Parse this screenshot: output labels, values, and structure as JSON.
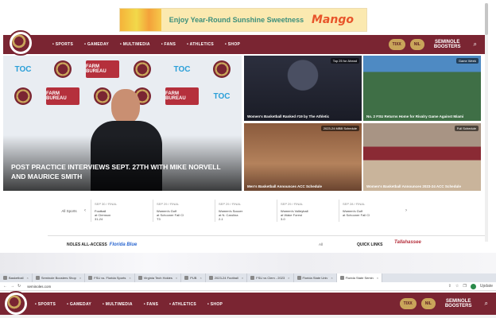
{
  "ad": {
    "tagline": "Enjoy Year-Round Sunshine Sweetness",
    "brand": "Mango"
  },
  "nav": {
    "links": [
      "• SPORTS",
      "• GAMEDAY",
      "• MULTIMEDIA",
      "• FANS",
      "• ATHLETICS",
      "• SHOP"
    ],
    "tickets": "TIXX",
    "nil": "NIL",
    "seminole_line1": "SEMINOLE",
    "seminole_line2": "BOOSTERS",
    "search_icon": "⌕"
  },
  "hero": {
    "title": "POST PRACTICE INTERVIEWS SEPT. 27TH WITH MIKE NORVELL AND MAURICE SMITH",
    "backdrop": [
      "TOC",
      "FARM BUREAU",
      "TOC",
      "FARM BUREAU",
      "TOC"
    ]
  },
  "tiles": [
    {
      "caption": "Women's Basketball Ranked #19 by The Athletic",
      "badge": "Top 25 for Ahead"
    },
    {
      "caption": "No. 2 FSU Returns Home for Rivalry Game Against Miami",
      "badge": "Game Week"
    },
    {
      "caption": "Men's Basketball Announces ACC Schedule",
      "badge": "2023-24 MBB Schedule"
    },
    {
      "caption": "Women's Basketball Announces 2023-24 ACC Schedule",
      "badge": "Full Schedule"
    }
  ],
  "scores": {
    "label": "All Sports",
    "prev_arrow": "‹",
    "next_arrow": "›",
    "items": [
      {
        "date": "SEP 30 / FINAL",
        "team": "Football",
        "opp": "at Clemson",
        "result": "W",
        "score": "31-24"
      },
      {
        "date": "SEP 29 / FINAL",
        "team": "Women's Golf",
        "opp": "at Schooner Fall Cl",
        "result": "T3",
        "score": ""
      },
      {
        "date": "SEP 29 / FINAL",
        "team": "Women's Soccer",
        "opp": "at N. Carolina",
        "result": "W",
        "score": "2-1"
      },
      {
        "date": "SEP 29 / FINAL",
        "team": "Women's Volleyball",
        "opp": "at Wake Forest",
        "result": "W",
        "score": "3-0"
      },
      {
        "date": "SEP 28 / FINAL",
        "team": "Women's Golf",
        "opp": "at Schooner Fall Cl",
        "result": "",
        "score": ""
      }
    ]
  },
  "allaccess": {
    "title": "NOLES ALL-ACCESS",
    "brand": "Florida Blue",
    "all_label": "All"
  },
  "quicklinks": {
    "title": "QUICK LINKS",
    "partner": "Tallahassee"
  },
  "browser": {
    "tabs": [
      {
        "label": "Basketball",
        "active": false
      },
      {
        "label": "Seminole Boosters Shop",
        "active": false
      },
      {
        "label": "FSU vs. Florida Sports",
        "active": false
      },
      {
        "label": "Virginia Tech Hokies",
        "active": false
      },
      {
        "label": "PUB",
        "active": false
      },
      {
        "label": "2023-24 Football",
        "active": false
      },
      {
        "label": "FSU vs Clem - 2023",
        "active": false
      },
      {
        "label": "Florida State Univ",
        "active": false
      },
      {
        "label": "Florida State Semin",
        "active": true
      }
    ],
    "url": "seminoles.com",
    "back": "←",
    "forward": "→",
    "reload": "↻",
    "update_label": "Update"
  }
}
